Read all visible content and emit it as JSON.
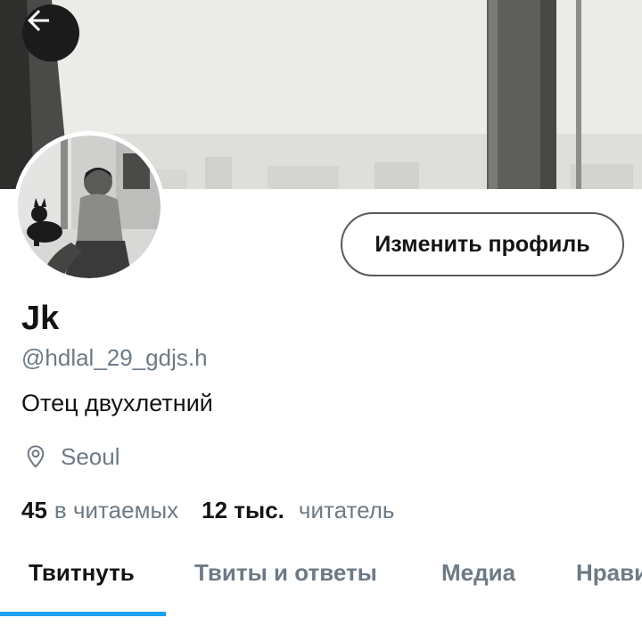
{
  "header": {
    "back_icon": "arrow-left-icon"
  },
  "profile": {
    "edit_button_label": "Изменить профиль",
    "display_name": "Jk",
    "handle": "@hdlal_29_gdjs.h",
    "bio": "Отец двухлетний",
    "location_icon": "location-pin-icon",
    "location": "Seoul"
  },
  "stats": {
    "following_count": "45",
    "following_label": "в читаемых",
    "followers_count": "12 тыс.",
    "followers_label": "читатель"
  },
  "tabs": [
    {
      "label": "Твитнуть",
      "active": true
    },
    {
      "label": "Твиты и ответы",
      "active": false
    },
    {
      "label": "Медиа",
      "active": false
    },
    {
      "label": "Нрави",
      "active": false
    }
  ],
  "colors": {
    "accent": "#1da1f2",
    "text_primary": "#141414",
    "text_secondary": "#6e7a85"
  }
}
